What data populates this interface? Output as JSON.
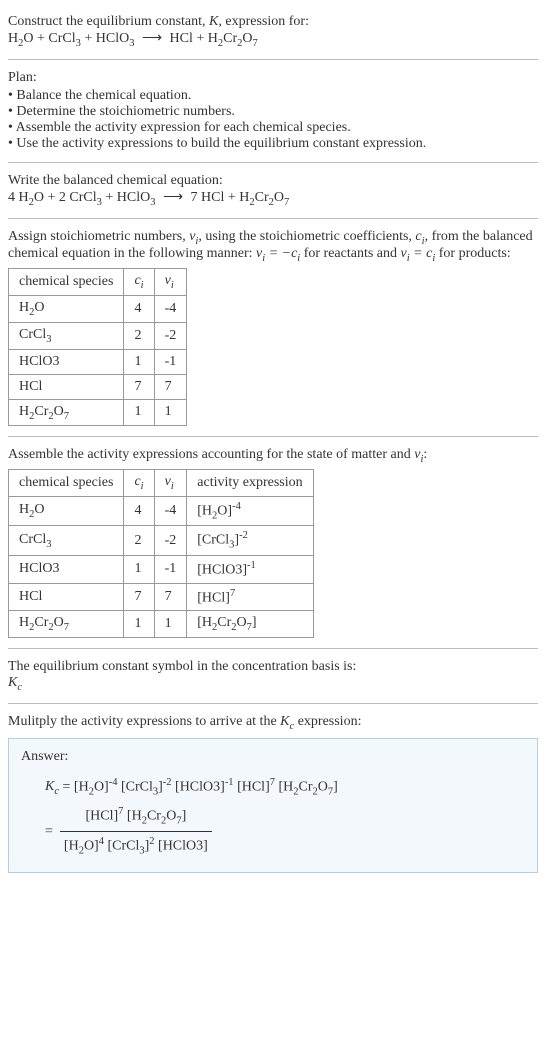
{
  "intro": {
    "line1": "Construct the equilibrium constant, ",
    "k": "K",
    "line1b": ", expression for:"
  },
  "plan": {
    "heading": "Plan:",
    "items": [
      "Balance the chemical equation.",
      "Determine the stoichiometric numbers.",
      "Assemble the activity expression for each chemical species.",
      "Use the activity expressions to build the equilibrium constant expression."
    ]
  },
  "balanced_heading": "Write the balanced chemical equation:",
  "stoich_text1": "Assign stoichiometric numbers, ",
  "stoich_text2": ", using the stoichiometric coefficients, ",
  "stoich_text3": ", from the balanced chemical equation in the following manner: ",
  "stoich_text4": " for reactants and ",
  "stoich_text5": " for products:",
  "table1": {
    "headers": [
      "chemical species",
      "cᵢ",
      "νᵢ"
    ],
    "rows": [
      {
        "sp": "H2O",
        "c": "4",
        "v": "-4"
      },
      {
        "sp": "CrCl3",
        "c": "2",
        "v": "-2"
      },
      {
        "sp": "HClO3",
        "c": "1",
        "v": "-1"
      },
      {
        "sp": "HCl",
        "c": "7",
        "v": "7"
      },
      {
        "sp": "H2Cr2O7",
        "c": "1",
        "v": "1"
      }
    ]
  },
  "activity_heading": "Assemble the activity expressions accounting for the state of matter and ",
  "table2": {
    "headers": [
      "chemical species",
      "cᵢ",
      "νᵢ",
      "activity expression"
    ],
    "rows": [
      {
        "sp": "H2O",
        "c": "4",
        "v": "-4",
        "exp": "-4"
      },
      {
        "sp": "CrCl3",
        "c": "2",
        "v": "-2",
        "exp": "-2"
      },
      {
        "sp": "HClO3",
        "c": "1",
        "v": "-1",
        "exp": "-1"
      },
      {
        "sp": "HCl",
        "c": "7",
        "v": "7",
        "exp": "7"
      },
      {
        "sp": "H2Cr2O7",
        "c": "1",
        "v": "1",
        "exp": ""
      }
    ]
  },
  "kc_heading": "The equilibrium constant symbol in the concentration basis is:",
  "kc_symbol": "K",
  "multiply_heading": "Mulitply the activity expressions to arrive at the ",
  "multiply_heading2": " expression:",
  "answer_label": "Answer:",
  "chart_data": {
    "type": "table",
    "title": "Stoichiometric numbers and activity expressions",
    "tables": [
      {
        "columns": [
          "chemical species",
          "c_i",
          "ν_i"
        ],
        "rows": [
          [
            "H2O",
            4,
            -4
          ],
          [
            "CrCl3",
            2,
            -2
          ],
          [
            "HClO3",
            1,
            -1
          ],
          [
            "HCl",
            7,
            7
          ],
          [
            "H2Cr2O7",
            1,
            1
          ]
        ]
      },
      {
        "columns": [
          "chemical species",
          "c_i",
          "ν_i",
          "activity expression"
        ],
        "rows": [
          [
            "H2O",
            4,
            -4,
            "[H2O]^-4"
          ],
          [
            "CrCl3",
            2,
            -2,
            "[CrCl3]^-2"
          ],
          [
            "HClO3",
            1,
            -1,
            "[HClO3]^-1"
          ],
          [
            "HCl",
            7,
            7,
            "[HCl]^7"
          ],
          [
            "H2Cr2O7",
            1,
            1,
            "[H2Cr2O7]"
          ]
        ]
      }
    ],
    "unbalanced_equation": "H2O + CrCl3 + HClO3 → HCl + H2Cr2O7",
    "balanced_equation": "4 H2O + 2 CrCl3 + HClO3 → 7 HCl + H2Cr2O7",
    "equilibrium_constant": "K_c = [H2O]^-4 [CrCl3]^-2 [HClO3]^-1 [HCl]^7 [H2Cr2O7] = ([HCl]^7 [H2Cr2O7]) / ([H2O]^4 [CrCl3]^2 [HClO3])"
  }
}
